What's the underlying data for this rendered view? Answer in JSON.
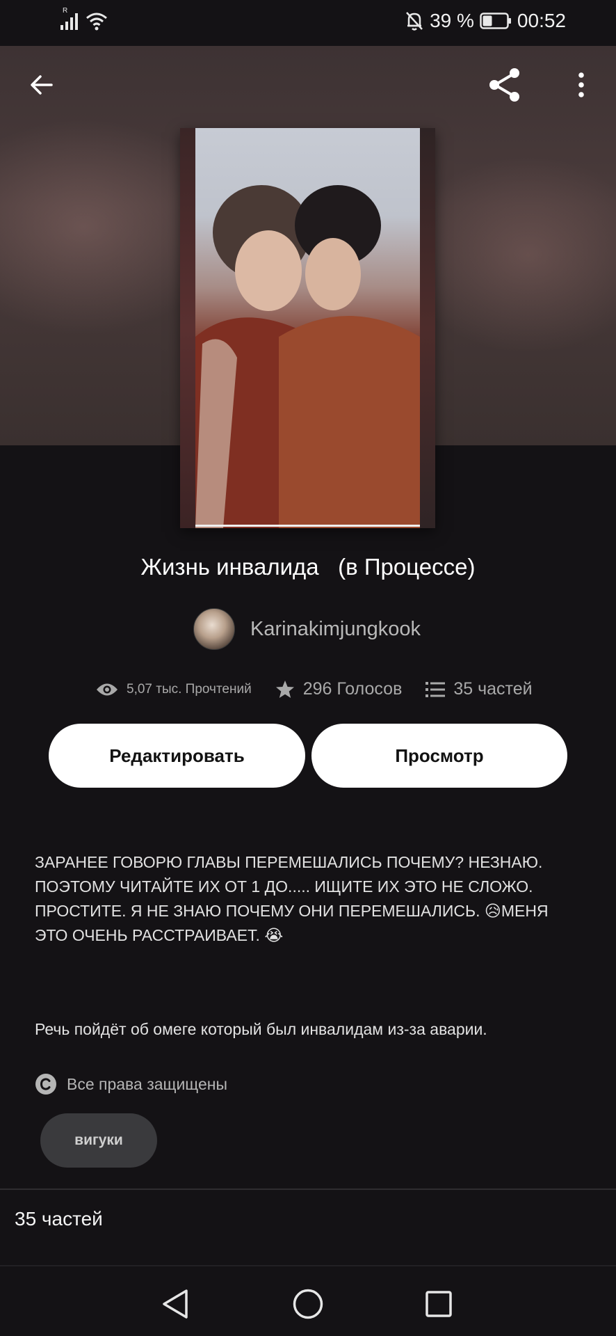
{
  "status_bar": {
    "network_indicator": "R",
    "battery_percent": "39 %",
    "time": "00:52",
    "icons": [
      "signal-icon",
      "wifi-icon",
      "bell-off-icon",
      "battery-icon"
    ]
  },
  "header": {
    "icons": [
      "back-arrow-icon",
      "share-icon",
      "more-vertical-icon"
    ]
  },
  "story": {
    "title": "Жизнь инвалида   (в Процессе)",
    "author": "Karinakimjungkook",
    "stats": {
      "reads": "5,07 тыс. Прочтений",
      "votes": "296 Голосов",
      "parts": "35 частей"
    },
    "buttons": {
      "edit": "Редактировать",
      "view": "Просмотр"
    },
    "description_lines": [
      "ЗАРАНЕЕ ГОВОРЮ ГЛАВЫ ПЕРЕМЕШАЛИСЬ ПОЧЕМУ? НЕЗНАЮ.",
      "ПОЭТОМУ ЧИТАЙТЕ ИХ ОТ 1 ДО..... ИЩИТЕ ИХ ЭТО НЕ СЛОЖО.",
      "ПРОСТИТЕ. Я НЕ ЗНАЮ ПОЧЕМУ ОНИ ПЕРЕМЕШАЛИСЬ. 😥МЕНЯ",
      "ЭТО ОЧЕНЬ РАССТРАИВАЕТ. 😭"
    ],
    "summary": "Речь пойдёт об омеге который был инвалидам из-за аварии.",
    "rights": "Все права защищены",
    "tag": "вигуки",
    "parts_section_label": "35 частей"
  },
  "nav_bar": {
    "icons": [
      "nav-back-icon",
      "nav-home-icon",
      "nav-recents-icon"
    ]
  },
  "colors": {
    "background": "#141215",
    "button_bg": "#ffffff",
    "tag_bg": "#3a3a3d",
    "muted_text": "#a9a9a9"
  }
}
